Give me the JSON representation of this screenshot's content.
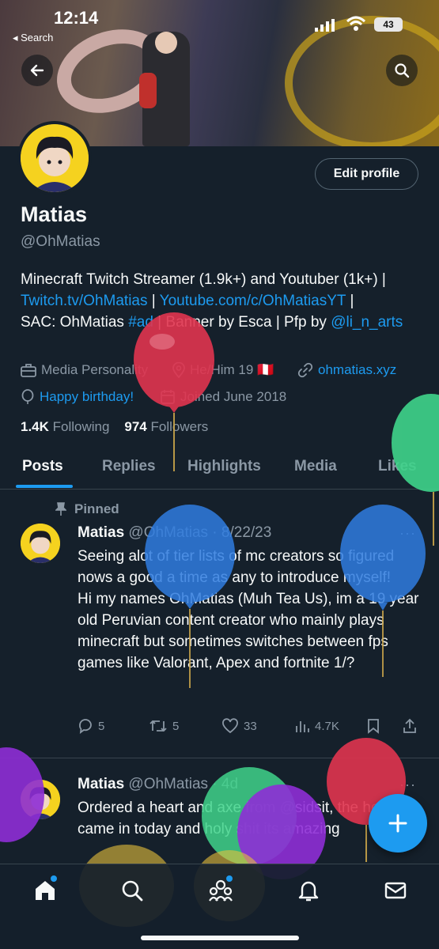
{
  "status": {
    "time": "12:14",
    "back_label": "◂ Search",
    "battery": "43"
  },
  "profile": {
    "name": "Matias",
    "handle": "@OhMatias",
    "edit_label": "Edit profile",
    "bio_text_1": "Minecraft Twitch Streamer (1.9k+) and Youtuber (1k+) |",
    "bio_link_1": "Twitch.tv/OhMatias",
    "bio_sep_1": " | ",
    "bio_link_2": "Youtube.com/c/OhMatiasYT",
    "bio_sep_2": " |",
    "bio_text_2": "SAC: OhMatias ",
    "bio_link_3": "#ad",
    "bio_text_3": " | Banner by Esca | Pfp by ",
    "bio_link_4": "@li_n_arts",
    "category": "Media Personality",
    "pronouns": "He/Him 19 🇵🇪",
    "website": "ohmatias.xyz",
    "birthday": "Happy birthday!",
    "joined": "Joined June 2018",
    "following_count": "1.4K",
    "following_label": "Following",
    "followers_count": "974",
    "followers_label": "Followers"
  },
  "tabs": [
    "Posts",
    "Replies",
    "Highlights",
    "Media",
    "Likes"
  ],
  "posts": [
    {
      "pinned_label": "Pinned",
      "author": "Matias",
      "meta": "@OhMatias · 8/22/23",
      "text": "Seeing alot of tier lists of mc creators so figured nows a good a time as any to introduce myself!\nHi my names OhMatias (Muh Tea Us), im a 19 year old Peruvian content creator who mainly plays minecraft but sometimes switches between fps games like Valorant, Apex and fortnite 1/?",
      "replies": "5",
      "reposts": "5",
      "likes": "33",
      "views": "4.7K"
    },
    {
      "author": "Matias",
      "meta": "@OhMatias · 4d",
      "text": "Ordered a heart and axe from @sidsit, the heart came in today and holy shit its amazing"
    }
  ],
  "colors": {
    "accent": "#1d9bf0",
    "background": "#15202b",
    "muted": "#8b98a5"
  }
}
